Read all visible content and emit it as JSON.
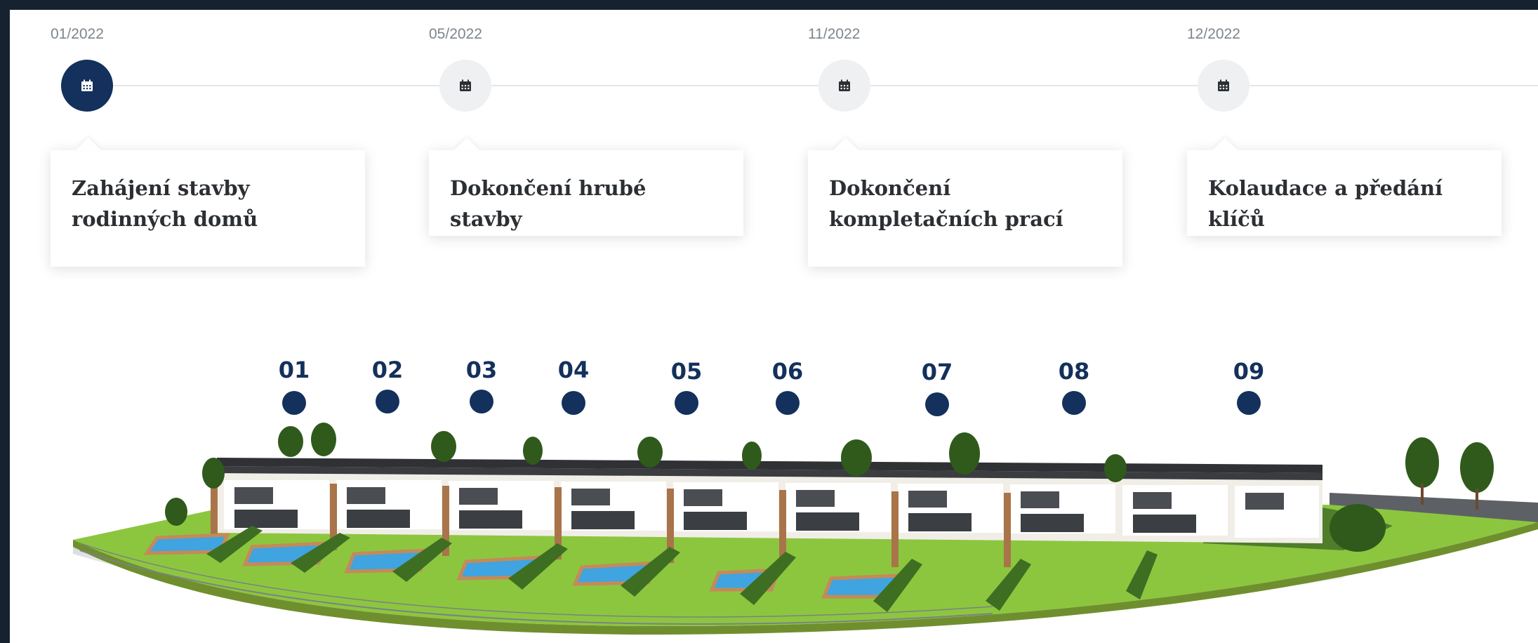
{
  "timeline": {
    "milestones": [
      {
        "date": "01/2022",
        "title": "Zahájení stavby rodinných domů",
        "active": true
      },
      {
        "date": "05/2022",
        "title": "Dokončení hrubé stavby",
        "active": false
      },
      {
        "date": "11/2022",
        "title": "Dokončení kompletačních prací",
        "active": false
      },
      {
        "date": "12/2022",
        "title": "Kolaudace a předání klíčů",
        "active": false
      }
    ],
    "icon": "calendar-icon"
  },
  "houses": {
    "labels": [
      "01",
      "02",
      "03",
      "04",
      "05",
      "06",
      "07",
      "08",
      "09"
    ]
  },
  "colors": {
    "accent": "#14305c",
    "inactive_node": "#eef0f2",
    "frame": "#16222f",
    "grass": "#8cc63f",
    "pool": "#3fa4e0"
  }
}
